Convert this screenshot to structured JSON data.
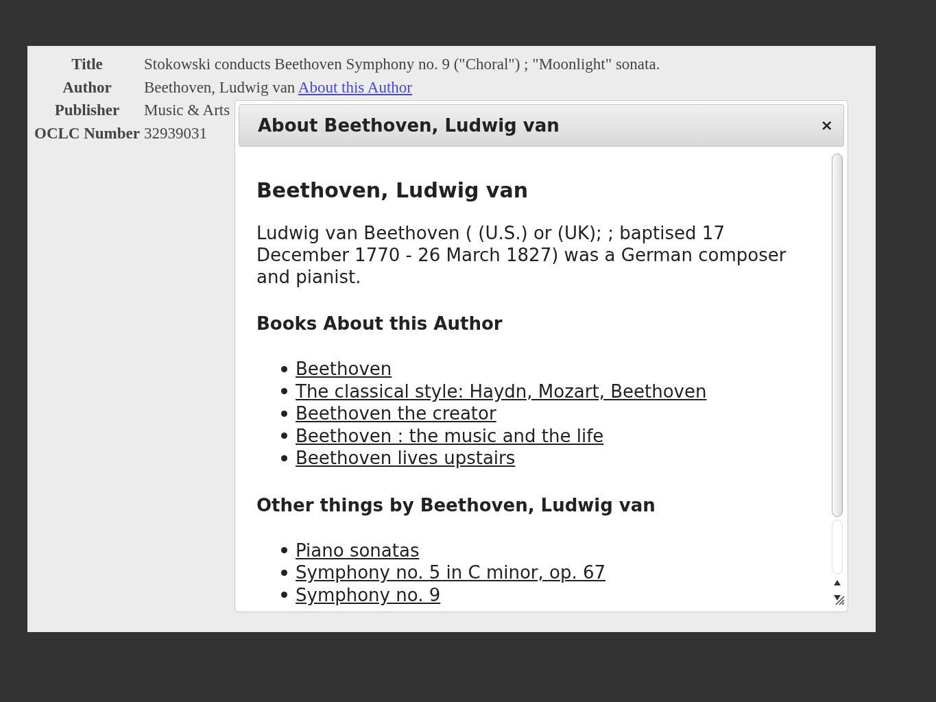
{
  "record": [
    {
      "label": "Title",
      "value": "Stokowski conducts Beethoven Symphony no. 9 (\"Choral\") ; \"Moonlight\" sonata."
    },
    {
      "label": "Author",
      "value": "Beethoven, Ludwig van",
      "link": "About this Author"
    },
    {
      "label": "Publisher",
      "value": "Music & Arts"
    },
    {
      "label": "OCLC Number",
      "value": "32939031"
    }
  ],
  "dialog": {
    "title": "About Beethoven, Ludwig van",
    "close": "×",
    "heading": "Beethoven, Ludwig van",
    "summary": "Ludwig van Beethoven ( (U.S.) or (UK); ; baptised 17 December 1770 - 26 March 1827) was a German composer and pianist.",
    "sections": [
      {
        "heading": "Books About this Author",
        "items": [
          "Beethoven",
          "The classical style: Haydn, Mozart, Beethoven",
          "Beethoven the creator",
          "Beethoven : the music and the life",
          "Beethoven lives upstairs"
        ]
      },
      {
        "heading": "Other things by Beethoven, Ludwig van",
        "items": [
          "Piano sonatas",
          "Symphony no. 5 in C minor, op. 67",
          "Symphony no. 9"
        ]
      }
    ]
  }
}
